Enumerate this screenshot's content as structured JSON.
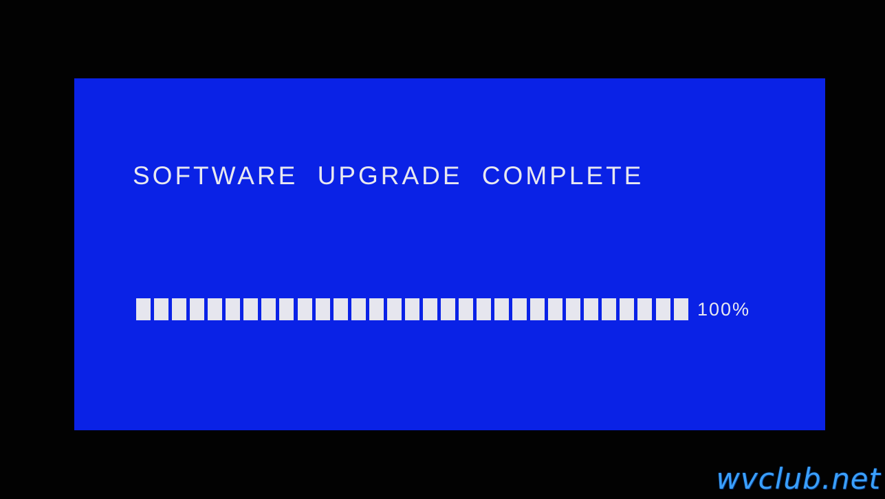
{
  "upgrade_screen": {
    "title": "SOFTWARE  UPGRADE  COMPLETE",
    "progress": {
      "fraction": 1.0,
      "segments": 31,
      "percent_label": "100%"
    }
  },
  "watermark": {
    "text": "wvclub.net"
  },
  "colors": {
    "panel_background": "#0a22e6",
    "frame_background": "#000000",
    "text": "#e8e8f0",
    "progress_segment": "#e6e6ee",
    "watermark": "#3aa0ff"
  }
}
